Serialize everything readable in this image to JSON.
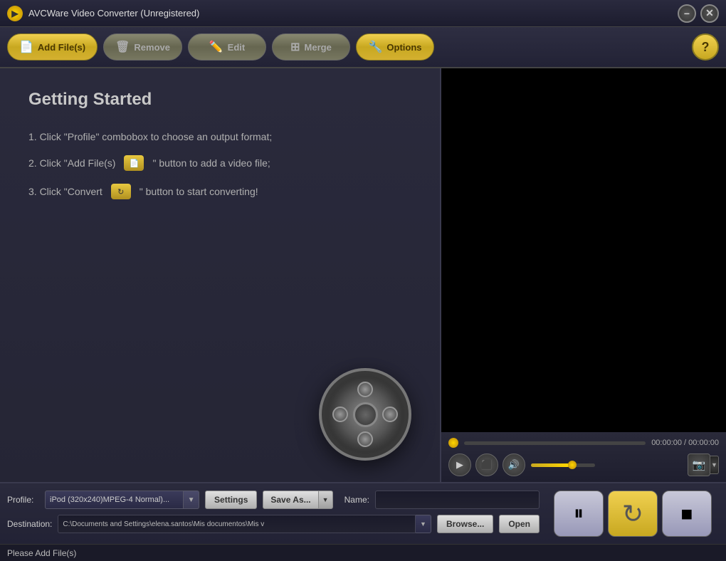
{
  "titleBar": {
    "title": "AVCWare Video Converter (Unregistered)",
    "minimizeLabel": "−",
    "closeLabel": "✕"
  },
  "toolbar": {
    "addFilesLabel": "Add File(s)",
    "removeLabel": "Remove",
    "editLabel": "Edit",
    "mergeLabel": "Merge",
    "optionsLabel": "Options",
    "helpLabel": "?"
  },
  "gettingStarted": {
    "title": "Getting Started",
    "step1": "1. Click \"Profile\" combobox to choose an output format;",
    "step2Text1": "2. Click \"Add File(s)",
    "step2Text2": "\" button to add a video file;",
    "step3Text1": "3. Click \"Convert",
    "step3Text2": "\" button to start converting!"
  },
  "videoPlayer": {
    "timeDisplay": "00:00:00 / 00:00:00"
  },
  "profileSection": {
    "profileLabel": "Profile:",
    "profileValue": "iPod (320x240)MPEG-4 Normal)...",
    "settingsLabel": "Settings",
    "saveAsLabel": "Save As...",
    "nameLabel": "Name:",
    "nameValue": "",
    "destinationLabel": "Destination:",
    "destinationPath": "C:\\Documents and Settings\\elena.santos\\Mis documentos\\Mis v",
    "browseLabel": "Browse...",
    "openLabel": "Open"
  },
  "actionButtons": {
    "pauseIcon": "⏸",
    "convertIcon": "↻",
    "stopIcon": "■"
  },
  "statusBar": {
    "message": "Please Add File(s)"
  }
}
